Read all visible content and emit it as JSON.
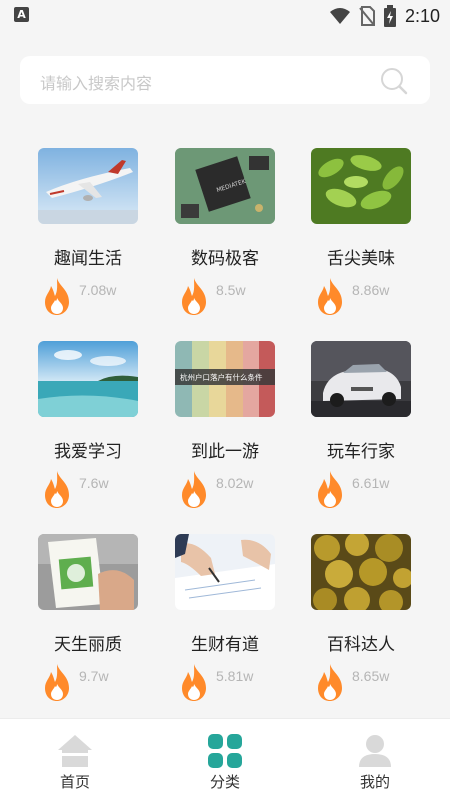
{
  "status_bar": {
    "left_icon_letter": "A",
    "time": "2:10",
    "icons": [
      "wifi-icon",
      "no-sim-icon",
      "battery-charging-icon"
    ]
  },
  "search": {
    "placeholder": "请输入搜索内容",
    "icon": "search-icon"
  },
  "categories": [
    {
      "title": "趣闻生活",
      "heat": "7.08w",
      "image": "airplane-photo"
    },
    {
      "title": "数码极客",
      "heat": "8.5w",
      "image": "chip-photo"
    },
    {
      "title": "舌尖美味",
      "heat": "8.86w",
      "image": "edamame-photo"
    },
    {
      "title": "我爱学习",
      "heat": "7.6w",
      "image": "beach-photo"
    },
    {
      "title": "到此一游",
      "heat": "8.02w",
      "image": "color-stripes-photo",
      "image_caption": "杭州户口落户有什么条件"
    },
    {
      "title": "玩车行家",
      "heat": "6.61w",
      "image": "car-photo"
    },
    {
      "title": "天生丽质",
      "heat": "9.7w",
      "image": "product-bag-photo"
    },
    {
      "title": "生财有道",
      "heat": "5.81w",
      "image": "writing-hand-photo"
    },
    {
      "title": "百科达人",
      "heat": "8.65w",
      "image": "durian-photo"
    }
  ],
  "tabbar": {
    "tabs": [
      {
        "label": "首页",
        "icon": "home-icon",
        "active": false
      },
      {
        "label": "分类",
        "icon": "category-grid-icon",
        "active": true
      },
      {
        "label": "我的",
        "icon": "profile-icon",
        "active": false
      }
    ],
    "active_color": "#26a69a",
    "inactive_color": "#d9d9d9"
  },
  "colors": {
    "background": "#f5f5f5",
    "fire": "#ff8a2a"
  }
}
